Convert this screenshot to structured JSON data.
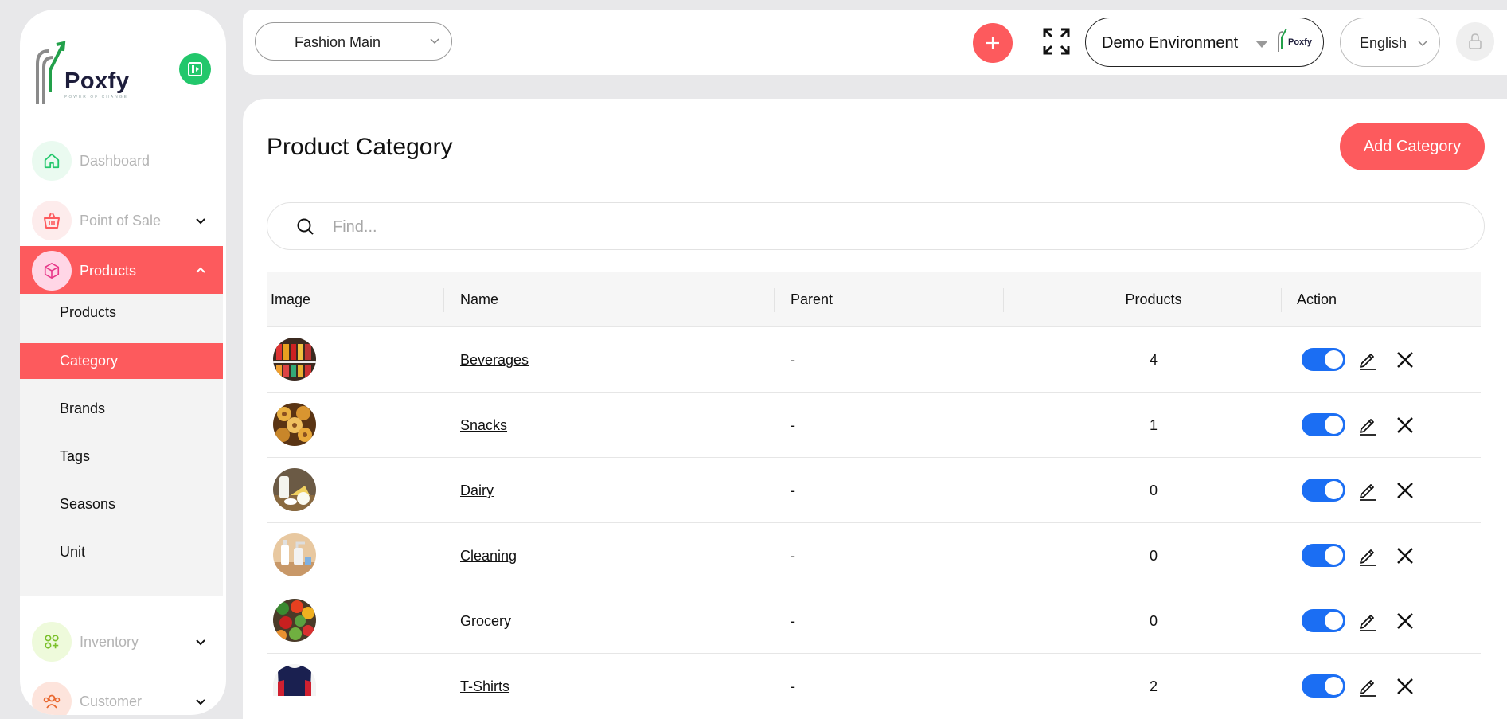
{
  "brand": {
    "name": "Poxfy",
    "tagline": "POWER OF CHANGE"
  },
  "sidebar": {
    "items": [
      {
        "label": "Dashboard"
      },
      {
        "label": "Point of Sale"
      },
      {
        "label": "Products"
      },
      {
        "label": "Inventory"
      },
      {
        "label": "Customer"
      }
    ],
    "products_submenu": [
      {
        "label": "Products"
      },
      {
        "label": "Category"
      },
      {
        "label": "Brands"
      },
      {
        "label": "Tags"
      },
      {
        "label": "Seasons"
      },
      {
        "label": "Unit"
      }
    ],
    "active_item": "Products",
    "active_subitem": "Category"
  },
  "topbar": {
    "store_select": "Fashion Main",
    "environment": "Demo Environment",
    "environment_logo_text": "Poxfy",
    "language": "English"
  },
  "page": {
    "title": "Product Category",
    "add_button": "Add Category",
    "search_placeholder": "Find..."
  },
  "table": {
    "columns": [
      "Image",
      "Name",
      "Parent",
      "Products",
      "Action"
    ],
    "rows": [
      {
        "name": "Beverages",
        "parent": "-",
        "products": "4",
        "enabled": true
      },
      {
        "name": "Snacks",
        "parent": "-",
        "products": "1",
        "enabled": true
      },
      {
        "name": "Dairy",
        "parent": "-",
        "products": "0",
        "enabled": true
      },
      {
        "name": "Cleaning",
        "parent": "-",
        "products": "0",
        "enabled": true
      },
      {
        "name": "Grocery",
        "parent": "-",
        "products": "0",
        "enabled": true
      },
      {
        "name": "T-Shirts",
        "parent": "-",
        "products": "2",
        "enabled": true
      }
    ]
  },
  "colors": {
    "accent": "#fd5a5d",
    "toggle_on": "#1b6ef3",
    "exit_button": "#22c76b"
  }
}
